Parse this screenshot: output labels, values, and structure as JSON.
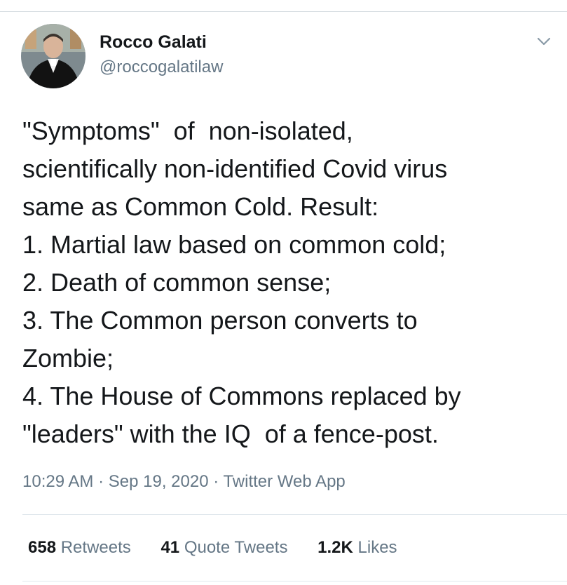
{
  "author": {
    "display_name": "Rocco Galati",
    "handle": "@roccogalatilaw",
    "avatar_icon": "user-avatar"
  },
  "tweet": {
    "lines": [
      "\"Symptoms\"  of  non-isolated,",
      "scientifically non-identified Covid virus",
      "same as Common Cold. Result:",
      "1. Martial law based on common cold;",
      "2. Death of common sense;",
      "3. The Common person converts to",
      "Zombie;",
      "4. The House of Commons replaced by",
      "\"leaders\" with the IQ  of a fence-post."
    ]
  },
  "meta": {
    "time": "10:29 AM",
    "separator": "·",
    "date": "Sep 19, 2020",
    "source": "Twitter Web App"
  },
  "stats": {
    "retweets_count": "658",
    "retweets_label": "Retweets",
    "quotes_count": "41",
    "quotes_label": "Quote Tweets",
    "likes_count": "1.2K",
    "likes_label": "Likes"
  },
  "colors": {
    "text_primary": "#14171a",
    "text_secondary": "#657786",
    "divider": "#e1e8ed"
  },
  "icons": {
    "menu": "chevron-down-icon"
  }
}
